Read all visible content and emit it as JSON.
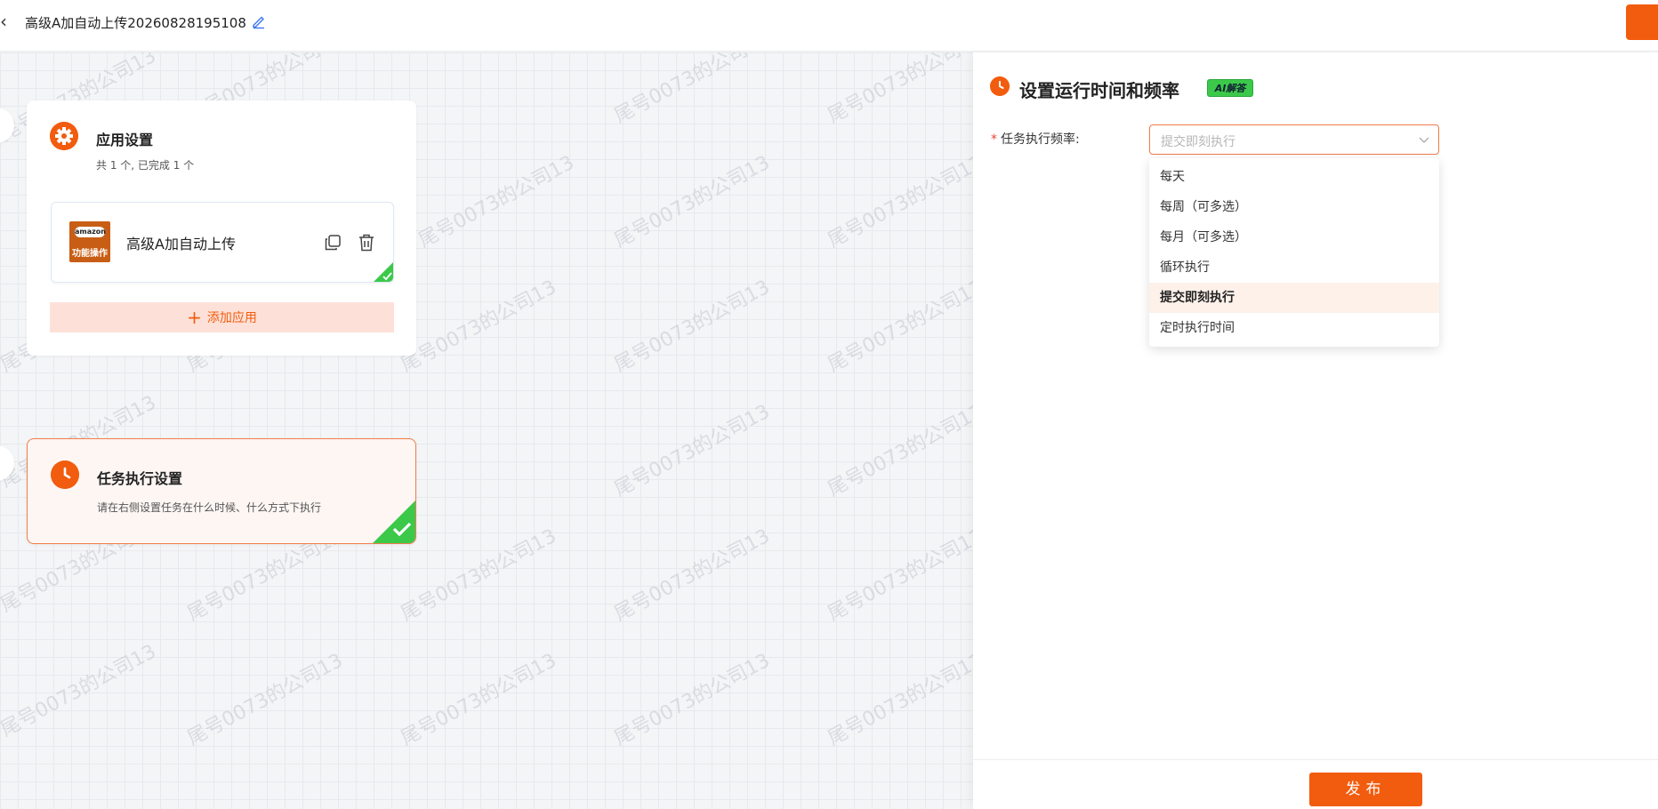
{
  "header": {
    "back_glyph": "‹",
    "title": "高级A加自动上传20260828195108"
  },
  "canvas": {
    "watermark_text": "尾号0073的公司13",
    "app_card": {
      "title": "应用设置",
      "subtitle": "共 1 个, 已完成 1 个",
      "app_item": {
        "logo_top": "amazon",
        "logo_bottom": "功能操作",
        "name": "高级A加自动上传"
      },
      "add_app_label": "添加应用"
    },
    "task_card": {
      "title": "任务执行设置",
      "subtitle": "请在右侧设置任务在什么时候、什么方式下执行"
    }
  },
  "panel": {
    "title": "设置运行时间和频率",
    "ai_badge": "AI解答",
    "form": {
      "required_mark": "*",
      "label": "任务执行频率:",
      "placeholder": "提交即刻执行"
    },
    "options": [
      "每天",
      "每周（可多选）",
      "每月（可多选）",
      "循环执行",
      "提交即刻执行",
      "定时执行时间"
    ],
    "selected_option_index": 4,
    "publish_label": "发布"
  },
  "colors": {
    "accent": "#f25c0e",
    "success": "#3cc94a",
    "add_app_bg": "#fde1d8"
  }
}
